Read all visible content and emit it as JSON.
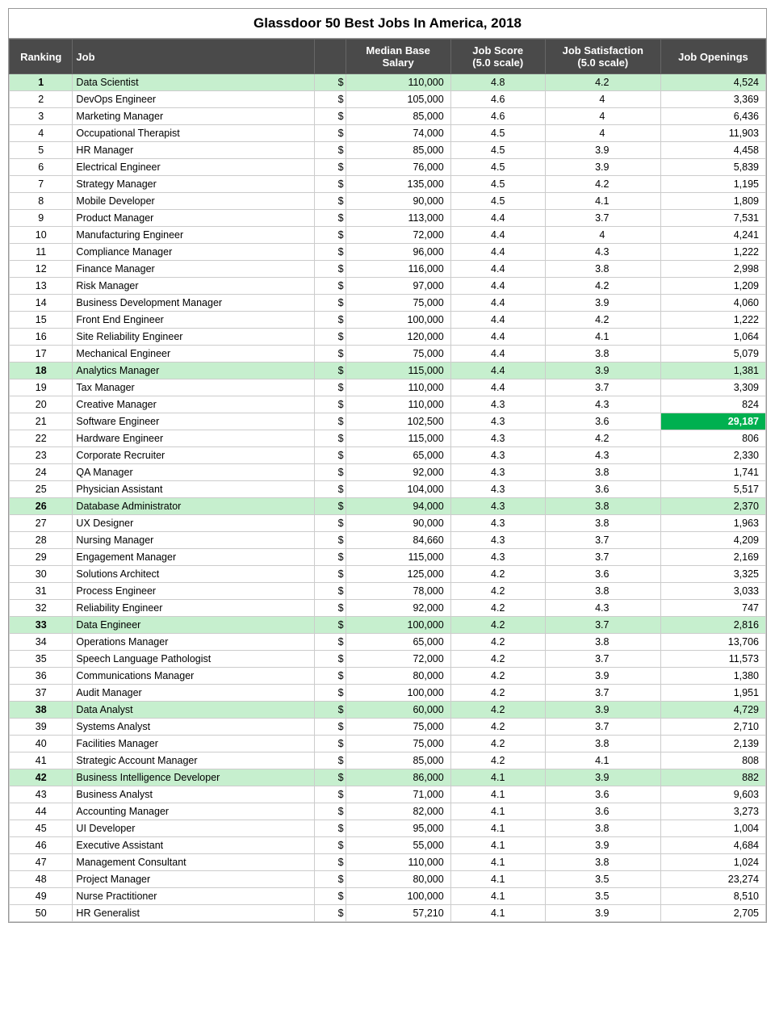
{
  "title": "Glassdoor 50 Best Jobs In America, 2018",
  "headers": [
    "Ranking",
    "Job",
    "Median Base\nSalary",
    "",
    "Job Score\n(5.0 scale)",
    "Job Satisfaction\n(5.0 scale)",
    "Job Openings"
  ],
  "rows": [
    {
      "rank": 1,
      "job": "Data Scientist",
      "salary": "110,000",
      "score": "4.8",
      "satisfaction": "4.2",
      "openings": "4,524",
      "highlight": "green"
    },
    {
      "rank": 2,
      "job": "DevOps Engineer",
      "salary": "105,000",
      "score": "4.6",
      "satisfaction": "4",
      "openings": "3,369",
      "highlight": "none"
    },
    {
      "rank": 3,
      "job": "Marketing Manager",
      "salary": "85,000",
      "score": "4.6",
      "satisfaction": "4",
      "openings": "6,436",
      "highlight": "none"
    },
    {
      "rank": 4,
      "job": "Occupational Therapist",
      "salary": "74,000",
      "score": "4.5",
      "satisfaction": "4",
      "openings": "11,903",
      "highlight": "none"
    },
    {
      "rank": 5,
      "job": "HR Manager",
      "salary": "85,000",
      "score": "4.5",
      "satisfaction": "3.9",
      "openings": "4,458",
      "highlight": "none"
    },
    {
      "rank": 6,
      "job": "Electrical Engineer",
      "salary": "76,000",
      "score": "4.5",
      "satisfaction": "3.9",
      "openings": "5,839",
      "highlight": "none"
    },
    {
      "rank": 7,
      "job": "Strategy Manager",
      "salary": "135,000",
      "score": "4.5",
      "satisfaction": "4.2",
      "openings": "1,195",
      "highlight": "none"
    },
    {
      "rank": 8,
      "job": "Mobile Developer",
      "salary": "90,000",
      "score": "4.5",
      "satisfaction": "4.1",
      "openings": "1,809",
      "highlight": "none"
    },
    {
      "rank": 9,
      "job": "Product Manager",
      "salary": "113,000",
      "score": "4.4",
      "satisfaction": "3.7",
      "openings": "7,531",
      "highlight": "none"
    },
    {
      "rank": 10,
      "job": "Manufacturing Engineer",
      "salary": "72,000",
      "score": "4.4",
      "satisfaction": "4",
      "openings": "4,241",
      "highlight": "none"
    },
    {
      "rank": 11,
      "job": "Compliance Manager",
      "salary": "96,000",
      "score": "4.4",
      "satisfaction": "4.3",
      "openings": "1,222",
      "highlight": "none"
    },
    {
      "rank": 12,
      "job": "Finance Manager",
      "salary": "116,000",
      "score": "4.4",
      "satisfaction": "3.8",
      "openings": "2,998",
      "highlight": "none"
    },
    {
      "rank": 13,
      "job": "Risk Manager",
      "salary": "97,000",
      "score": "4.4",
      "satisfaction": "4.2",
      "openings": "1,209",
      "highlight": "none"
    },
    {
      "rank": 14,
      "job": "Business Development Manager",
      "salary": "75,000",
      "score": "4.4",
      "satisfaction": "3.9",
      "openings": "4,060",
      "highlight": "none"
    },
    {
      "rank": 15,
      "job": "Front End Engineer",
      "salary": "100,000",
      "score": "4.4",
      "satisfaction": "4.2",
      "openings": "1,222",
      "highlight": "none"
    },
    {
      "rank": 16,
      "job": "Site Reliability Engineer",
      "salary": "120,000",
      "score": "4.4",
      "satisfaction": "4.1",
      "openings": "1,064",
      "highlight": "none"
    },
    {
      "rank": 17,
      "job": "Mechanical Engineer",
      "salary": "75,000",
      "score": "4.4",
      "satisfaction": "3.8",
      "openings": "5,079",
      "highlight": "none"
    },
    {
      "rank": 18,
      "job": "Analytics Manager",
      "salary": "115,000",
      "score": "4.4",
      "satisfaction": "3.9",
      "openings": "1,381",
      "highlight": "green"
    },
    {
      "rank": 19,
      "job": "Tax Manager",
      "salary": "110,000",
      "score": "4.4",
      "satisfaction": "3.7",
      "openings": "3,309",
      "highlight": "none"
    },
    {
      "rank": 20,
      "job": "Creative Manager",
      "salary": "110,000",
      "score": "4.3",
      "satisfaction": "4.3",
      "openings": "824",
      "highlight": "none"
    },
    {
      "rank": 21,
      "job": "Software Engineer",
      "salary": "102,500",
      "score": "4.3",
      "satisfaction": "3.6",
      "openings": "29,187",
      "highlight": "bright-green"
    },
    {
      "rank": 22,
      "job": "Hardware Engineer",
      "salary": "115,000",
      "score": "4.3",
      "satisfaction": "4.2",
      "openings": "806",
      "highlight": "none"
    },
    {
      "rank": 23,
      "job": "Corporate Recruiter",
      "salary": "65,000",
      "score": "4.3",
      "satisfaction": "4.3",
      "openings": "2,330",
      "highlight": "none"
    },
    {
      "rank": 24,
      "job": "QA Manager",
      "salary": "92,000",
      "score": "4.3",
      "satisfaction": "3.8",
      "openings": "1,741",
      "highlight": "none"
    },
    {
      "rank": 25,
      "job": "Physician Assistant",
      "salary": "104,000",
      "score": "4.3",
      "satisfaction": "3.6",
      "openings": "5,517",
      "highlight": "none"
    },
    {
      "rank": 26,
      "job": "Database Administrator",
      "salary": "94,000",
      "score": "4.3",
      "satisfaction": "3.8",
      "openings": "2,370",
      "highlight": "green"
    },
    {
      "rank": 27,
      "job": "UX Designer",
      "salary": "90,000",
      "score": "4.3",
      "satisfaction": "3.8",
      "openings": "1,963",
      "highlight": "none"
    },
    {
      "rank": 28,
      "job": "Nursing Manager",
      "salary": "84,660",
      "score": "4.3",
      "satisfaction": "3.7",
      "openings": "4,209",
      "highlight": "none"
    },
    {
      "rank": 29,
      "job": "Engagement Manager",
      "salary": "115,000",
      "score": "4.3",
      "satisfaction": "3.7",
      "openings": "2,169",
      "highlight": "none"
    },
    {
      "rank": 30,
      "job": "Solutions Architect",
      "salary": "125,000",
      "score": "4.2",
      "satisfaction": "3.6",
      "openings": "3,325",
      "highlight": "none"
    },
    {
      "rank": 31,
      "job": "Process Engineer",
      "salary": "78,000",
      "score": "4.2",
      "satisfaction": "3.8",
      "openings": "3,033",
      "highlight": "none"
    },
    {
      "rank": 32,
      "job": "Reliability Engineer",
      "salary": "92,000",
      "score": "4.2",
      "satisfaction": "4.3",
      "openings": "747",
      "highlight": "none"
    },
    {
      "rank": 33,
      "job": "Data Engineer",
      "salary": "100,000",
      "score": "4.2",
      "satisfaction": "3.7",
      "openings": "2,816",
      "highlight": "green"
    },
    {
      "rank": 34,
      "job": "Operations Manager",
      "salary": "65,000",
      "score": "4.2",
      "satisfaction": "3.8",
      "openings": "13,706",
      "highlight": "none"
    },
    {
      "rank": 35,
      "job": "Speech Language Pathologist",
      "salary": "72,000",
      "score": "4.2",
      "satisfaction": "3.7",
      "openings": "11,573",
      "highlight": "none"
    },
    {
      "rank": 36,
      "job": "Communications Manager",
      "salary": "80,000",
      "score": "4.2",
      "satisfaction": "3.9",
      "openings": "1,380",
      "highlight": "none"
    },
    {
      "rank": 37,
      "job": "Audit Manager",
      "salary": "100,000",
      "score": "4.2",
      "satisfaction": "3.7",
      "openings": "1,951",
      "highlight": "none"
    },
    {
      "rank": 38,
      "job": "Data Analyst",
      "salary": "60,000",
      "score": "4.2",
      "satisfaction": "3.9",
      "openings": "4,729",
      "highlight": "green"
    },
    {
      "rank": 39,
      "job": "Systems Analyst",
      "salary": "75,000",
      "score": "4.2",
      "satisfaction": "3.7",
      "openings": "2,710",
      "highlight": "none"
    },
    {
      "rank": 40,
      "job": "Facilities Manager",
      "salary": "75,000",
      "score": "4.2",
      "satisfaction": "3.8",
      "openings": "2,139",
      "highlight": "none"
    },
    {
      "rank": 41,
      "job": "Strategic Account Manager",
      "salary": "85,000",
      "score": "4.2",
      "satisfaction": "4.1",
      "openings": "808",
      "highlight": "none"
    },
    {
      "rank": 42,
      "job": "Business Intelligence Developer",
      "salary": "86,000",
      "score": "4.1",
      "satisfaction": "3.9",
      "openings": "882",
      "highlight": "green"
    },
    {
      "rank": 43,
      "job": "Business Analyst",
      "salary": "71,000",
      "score": "4.1",
      "satisfaction": "3.6",
      "openings": "9,603",
      "highlight": "none"
    },
    {
      "rank": 44,
      "job": "Accounting Manager",
      "salary": "82,000",
      "score": "4.1",
      "satisfaction": "3.6",
      "openings": "3,273",
      "highlight": "none"
    },
    {
      "rank": 45,
      "job": "UI Developer",
      "salary": "95,000",
      "score": "4.1",
      "satisfaction": "3.8",
      "openings": "1,004",
      "highlight": "none"
    },
    {
      "rank": 46,
      "job": "Executive Assistant",
      "salary": "55,000",
      "score": "4.1",
      "satisfaction": "3.9",
      "openings": "4,684",
      "highlight": "none"
    },
    {
      "rank": 47,
      "job": "Management Consultant",
      "salary": "110,000",
      "score": "4.1",
      "satisfaction": "3.8",
      "openings": "1,024",
      "highlight": "none"
    },
    {
      "rank": 48,
      "job": "Project Manager",
      "salary": "80,000",
      "score": "4.1",
      "satisfaction": "3.5",
      "openings": "23,274",
      "highlight": "none"
    },
    {
      "rank": 49,
      "job": "Nurse Practitioner",
      "salary": "100,000",
      "score": "4.1",
      "satisfaction": "3.5",
      "openings": "8,510",
      "highlight": "none"
    },
    {
      "rank": 50,
      "job": "HR Generalist",
      "salary": "57,210",
      "score": "4.1",
      "satisfaction": "3.9",
      "openings": "2,705",
      "highlight": "none"
    }
  ]
}
